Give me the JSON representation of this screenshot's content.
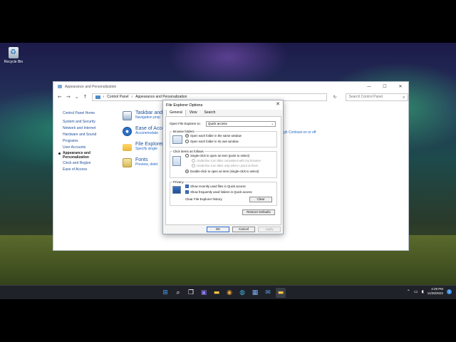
{
  "desktop": {
    "recycle_bin_label": "Recycle Bin"
  },
  "control_panel": {
    "title": "Appearance and Personalization",
    "controls": {
      "minimize": "—",
      "maximize": "☐",
      "close": "✕"
    },
    "nav": {
      "back": "←",
      "forward": "→",
      "recent": "⌄",
      "up": "↑"
    },
    "breadcrumb": [
      "Control Panel",
      "Appearance and Personalization"
    ],
    "refresh": "↻",
    "search_placeholder": "Search Control Panel",
    "sidebar": [
      "Control Panel Home",
      "System and Security",
      "Network and Internet",
      "Hardware and Sound",
      "Programs",
      "User Accounts",
      "Appearance and Personalization",
      "Clock and Region",
      "Ease of Access"
    ],
    "items": [
      {
        "title": "Taskbar and",
        "sub": "Navigation prop",
        "icon": "taskbar-icon"
      },
      {
        "title": "Ease of Acce",
        "sub": "Accommodate",
        "icon": "ease-of-access-icon"
      },
      {
        "title": "File Explorer",
        "sub": "Specify single",
        "icon": "folder-icon"
      },
      {
        "title": "Fonts",
        "sub": "Preview, delet",
        "icon": "fonts-icon"
      }
    ],
    "high_contrast_link": "gh Contrast on or off"
  },
  "dialog": {
    "title": "File Explorer Options",
    "tabs": [
      "General",
      "View",
      "Search"
    ],
    "open_label": "Open File Explorer to:",
    "open_value": "Quick access",
    "browse": {
      "legend": "Browse folders",
      "opt_same": "Open each folder in the same window",
      "opt_own": "Open each folder in its own window"
    },
    "click": {
      "legend": "Click items as follows",
      "opt_single": "Single-click to open an item (point to select)",
      "opt_underline_browser": "Underline icon titles consistent with my browser",
      "opt_underline_point": "Underline icon titles only when I point at them",
      "opt_double": "Double-click to open an item (single-click to select)"
    },
    "privacy": {
      "legend": "Privacy",
      "show_recent": "Show recently used files in Quick access",
      "show_frequent": "Show frequently used folders in Quick access",
      "clear_label": "Clear File Explorer history",
      "clear_button": "Clear"
    },
    "restore_defaults": "Restore Defaults",
    "ok": "OK",
    "cancel": "Cancel",
    "apply": "Apply"
  },
  "taskbar": {
    "clock_time": "4:29 PM",
    "clock_date": "11/28/2022",
    "notification_count": "1"
  },
  "colors": {
    "accent": "#2a5caa",
    "link": "#1e66c8"
  }
}
